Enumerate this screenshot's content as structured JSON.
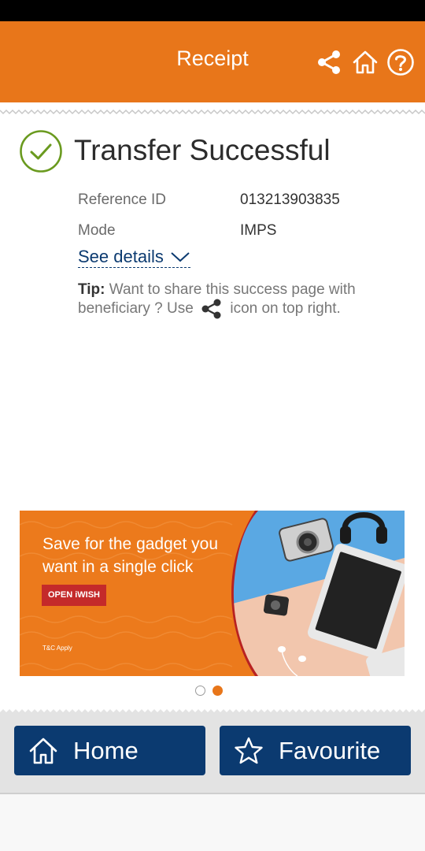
{
  "header": {
    "title": "Receipt",
    "icons": [
      "share-icon",
      "home-icon",
      "help-icon"
    ],
    "color": "#e8761a"
  },
  "status": {
    "title": "Transfer Successful",
    "icon": "check-circle-icon",
    "icon_color": "#6a9a1f"
  },
  "details": {
    "reference_label": "Reference ID",
    "reference_value": "013213903835",
    "mode_label": "Mode",
    "mode_value": "IMPS",
    "see_details": "See details"
  },
  "tip": {
    "label": "Tip:",
    "text_before": "Want to share this success page with beneficiary ? Use",
    "text_after": "icon on top right."
  },
  "banner": {
    "headline": "Save for the gadget you want in a single click",
    "cta": "OPEN iWISH",
    "tnc": "T&C Apply",
    "slide_count": 2,
    "active_slide": 2
  },
  "footer": {
    "home_label": "Home",
    "favourite_label": "Favourite",
    "button_color": "#0b3a70"
  }
}
